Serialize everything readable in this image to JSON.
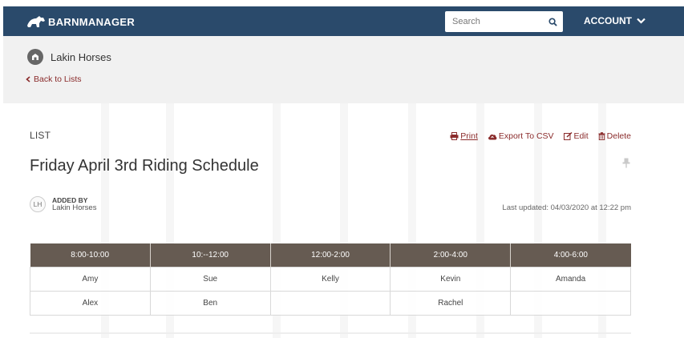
{
  "header": {
    "logo_text": "BARNMANAGER",
    "search_placeholder": "Search",
    "account_label": "ACCOUNT"
  },
  "subheader": {
    "breed_name": "Lakin Horses",
    "back_label": "Back to Lists"
  },
  "list": {
    "section_label": "LIST",
    "title": "Friday April 3rd Riding Schedule",
    "actions": {
      "print": "Print",
      "export": "Export To CSV",
      "edit": "Edit",
      "delete": "Delete"
    },
    "added_by_label": "ADDED BY",
    "added_by": "Lakin Horses",
    "avatar_initials": "LH",
    "last_updated": "Last updated: 04/03/2020 at 12:22 pm"
  },
  "table": {
    "headers": [
      "8:00-10:00",
      "10:--12:00",
      "12:00-2:00",
      "2:00-4:00",
      "4:00-6:00"
    ],
    "rows": [
      [
        "Amy",
        "Sue",
        "Kelly",
        "Kevin",
        "Amanda"
      ],
      [
        "Alex",
        "Ben",
        "",
        "Rachel",
        ""
      ]
    ]
  },
  "colors": {
    "navbar": "#2a4a6b",
    "accent_link": "#8a2b2b",
    "table_header": "#665b52"
  },
  "icons": [
    "horse-logo-icon",
    "search-icon",
    "chevron-down-icon",
    "breed-icon",
    "chevron-left-icon",
    "print-icon",
    "cloud-upload-icon",
    "edit-icon",
    "trash-icon",
    "pin-icon"
  ]
}
